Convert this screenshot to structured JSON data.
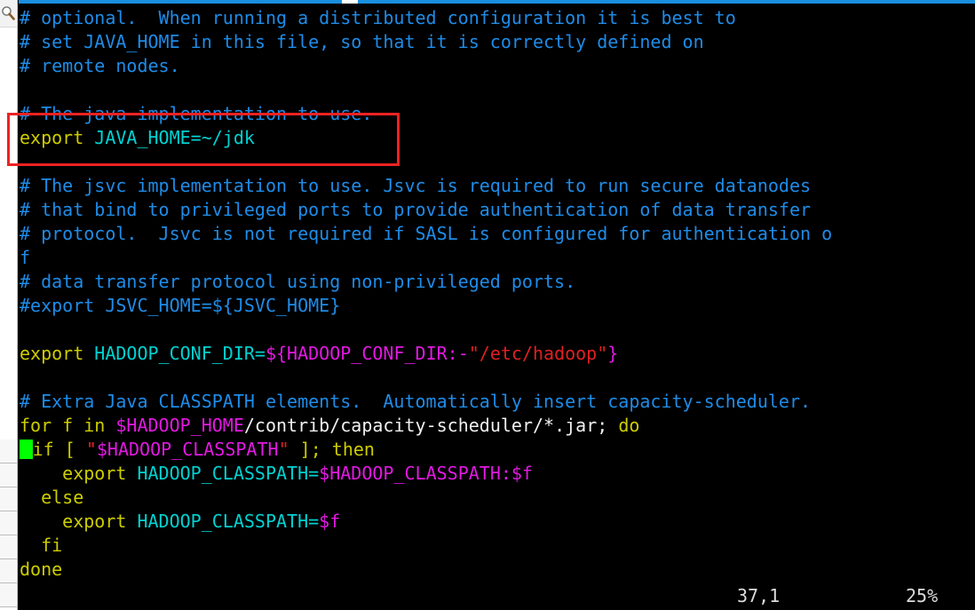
{
  "window": {
    "kind": "terminal-text-editor",
    "background": "#000000",
    "accent_blue": "#1a8fe0",
    "annotation_color": "#ee2222",
    "cursor_color": "#00ff00"
  },
  "left_panel": {
    "magnifier_icon": "search-icon",
    "row_count": 7
  },
  "editor": {
    "lines": [
      {
        "id": "l1",
        "tokens": [
          {
            "t": "# optional.  When running a distributed configuration it is best to",
            "c": "c-comment"
          }
        ]
      },
      {
        "id": "l2",
        "tokens": [
          {
            "t": "# set JAVA_HOME in this file, so that it is correctly defined on",
            "c": "c-comment"
          }
        ]
      },
      {
        "id": "l3",
        "tokens": [
          {
            "t": "# remote nodes.",
            "c": "c-comment"
          }
        ]
      },
      {
        "id": "l4",
        "tokens": [
          {
            "t": "",
            "c": "c-plain"
          }
        ]
      },
      {
        "id": "l5",
        "tokens": [
          {
            "t": "# The java implementation to use.",
            "c": "c-comment"
          }
        ]
      },
      {
        "id": "l6",
        "tokens": [
          {
            "t": "export ",
            "c": "c-keyword"
          },
          {
            "t": "JAVA_HOME=~/jdk",
            "c": "c-ident"
          }
        ]
      },
      {
        "id": "l7",
        "tokens": [
          {
            "t": "",
            "c": "c-plain"
          }
        ]
      },
      {
        "id": "l8",
        "tokens": [
          {
            "t": "# The jsvc implementation to use. Jsvc is required to run secure datanodes",
            "c": "c-comment"
          }
        ]
      },
      {
        "id": "l9",
        "tokens": [
          {
            "t": "# that bind to privileged ports to provide authentication of data transfer",
            "c": "c-comment"
          }
        ]
      },
      {
        "id": "l10",
        "tokens": [
          {
            "t": "# protocol.  Jsvc is not required if SASL is configured for authentication o",
            "c": "c-comment"
          }
        ]
      },
      {
        "id": "l11",
        "tokens": [
          {
            "t": "f",
            "c": "c-comment"
          }
        ]
      },
      {
        "id": "l12",
        "tokens": [
          {
            "t": "# data transfer protocol using non-privileged ports.",
            "c": "c-comment"
          }
        ]
      },
      {
        "id": "l13",
        "tokens": [
          {
            "t": "#export JSVC_HOME=${JSVC_HOME}",
            "c": "c-comment"
          }
        ]
      },
      {
        "id": "l14",
        "tokens": [
          {
            "t": "",
            "c": "c-plain"
          }
        ]
      },
      {
        "id": "l15",
        "tokens": [
          {
            "t": "export ",
            "c": "c-keyword"
          },
          {
            "t": "HADOOP_CONF_DIR=",
            "c": "c-ident"
          },
          {
            "t": "${HADOOP_CONF_DIR:-",
            "c": "c-var"
          },
          {
            "t": "\"/etc/hadoop\"",
            "c": "c-string"
          },
          {
            "t": "}",
            "c": "c-var"
          }
        ]
      },
      {
        "id": "l16",
        "tokens": [
          {
            "t": "",
            "c": "c-plain"
          }
        ]
      },
      {
        "id": "l17",
        "tokens": [
          {
            "t": "# Extra Java CLASSPATH elements.  Automatically insert capacity-scheduler.",
            "c": "c-comment"
          }
        ]
      },
      {
        "id": "l18",
        "tokens": [
          {
            "t": "for f in ",
            "c": "c-keyword"
          },
          {
            "t": "$HADOOP_HOME",
            "c": "c-var"
          },
          {
            "t": "/contrib/capacity-scheduler/*.jar; ",
            "c": "c-plain"
          },
          {
            "t": "do",
            "c": "c-keyword"
          }
        ]
      },
      {
        "id": "l19",
        "cursor_at": 0,
        "tokens": [
          {
            "t": " if [ ",
            "c": "c-keyword"
          },
          {
            "t": "\"",
            "c": "c-string"
          },
          {
            "t": "$HADOOP_CLASSPATH",
            "c": "c-var"
          },
          {
            "t": "\"",
            "c": "c-string"
          },
          {
            "t": " ]; then",
            "c": "c-keyword"
          }
        ]
      },
      {
        "id": "l20",
        "tokens": [
          {
            "t": "    export ",
            "c": "c-keyword"
          },
          {
            "t": "HADOOP_CLASSPATH=",
            "c": "c-ident"
          },
          {
            "t": "$HADOOP_CLASSPATH:$f",
            "c": "c-var"
          }
        ]
      },
      {
        "id": "l21",
        "tokens": [
          {
            "t": "  else",
            "c": "c-keyword"
          }
        ]
      },
      {
        "id": "l22",
        "tokens": [
          {
            "t": "    export ",
            "c": "c-keyword"
          },
          {
            "t": "HADOOP_CLASSPATH=",
            "c": "c-ident"
          },
          {
            "t": "$f",
            "c": "c-var"
          }
        ]
      },
      {
        "id": "l23",
        "tokens": [
          {
            "t": "  fi",
            "c": "c-keyword"
          }
        ]
      },
      {
        "id": "l24",
        "tokens": [
          {
            "t": "done",
            "c": "c-keyword"
          }
        ]
      }
    ]
  },
  "annotation": {
    "label": "highlight-box-java-home",
    "target_line": "export JAVA_HOME=~/jdk"
  },
  "status": {
    "position": "37,1",
    "percent": "25%"
  }
}
